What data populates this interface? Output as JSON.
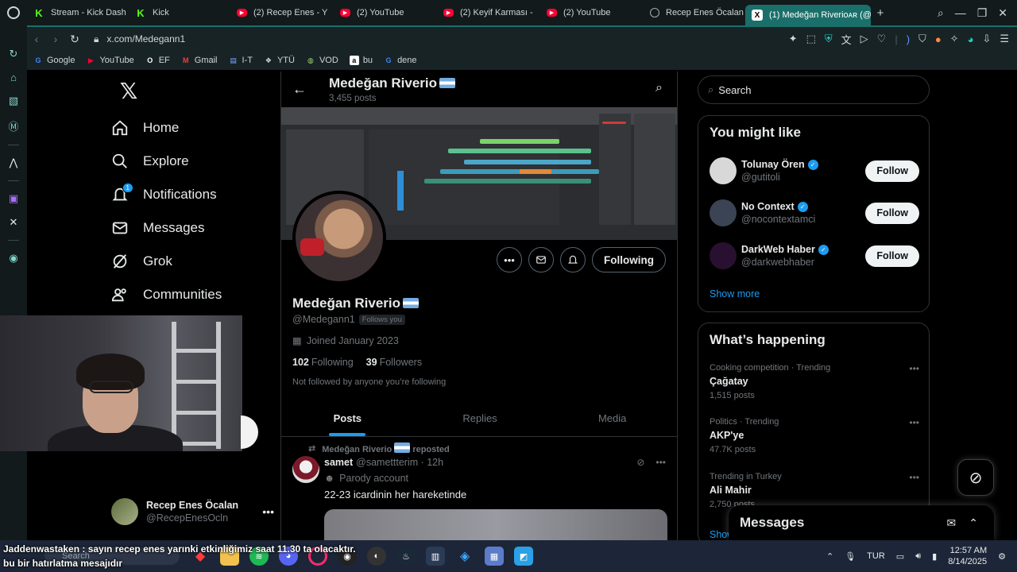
{
  "browser": {
    "tabs": [
      {
        "label": "Stream - Kick Dash",
        "icon": "kick-icon",
        "active": false
      },
      {
        "label": "Kick",
        "icon": "kick-icon",
        "active": false
      },
      {
        "label": "(2) Recep Enes - Y",
        "icon": "youtube-icon",
        "active": false
      },
      {
        "label": "(2) YouTube",
        "icon": "youtube-icon",
        "active": false
      },
      {
        "label": "(2) Keyif Karması -",
        "icon": "youtube-icon",
        "active": false
      },
      {
        "label": "(2) YouTube",
        "icon": "youtube-icon",
        "active": false
      },
      {
        "label": "Recep Enes Öcalan",
        "icon": "globe-icon",
        "active": false
      },
      {
        "label": "(1) Medeğan Riverioᴀʀ (@",
        "icon": "x-icon",
        "active": true
      }
    ],
    "url": "x.com/Medegann1",
    "bookmarks": [
      {
        "label": "Google",
        "icon": "google-icon"
      },
      {
        "label": "YouTube",
        "icon": "youtube-icon"
      },
      {
        "label": "EF",
        "icon": "ef-icon"
      },
      {
        "label": "Gmail",
        "icon": "gmail-icon"
      },
      {
        "label": "I-T",
        "icon": "folder-icon"
      },
      {
        "label": "YTÜ",
        "icon": "ytu-icon"
      },
      {
        "label": "VOD",
        "icon": "vod-icon"
      },
      {
        "label": "bu",
        "icon": "amazon-icon"
      },
      {
        "label": "dene",
        "icon": "google-icon"
      }
    ],
    "accent": "#1b6f6a"
  },
  "x_nav": {
    "items": [
      {
        "label": "Home",
        "icon": "home-icon"
      },
      {
        "label": "Explore",
        "icon": "search-icon"
      },
      {
        "label": "Notifications",
        "icon": "bell-icon",
        "badge": "1"
      },
      {
        "label": "Messages",
        "icon": "mail-icon"
      },
      {
        "label": "Grok",
        "icon": "grok-icon"
      },
      {
        "label": "Communities",
        "icon": "people-icon"
      }
    ],
    "account": {
      "name": "Recep Enes Öcalan",
      "handle": "@RecepEnesOcln"
    }
  },
  "profile": {
    "header_name": "Medeğan Riverio",
    "header_posts": "3,455 posts",
    "name": "Medeğan Riverio",
    "handle": "@Medegann1",
    "follows_you": "Follows you",
    "joined": "Joined January 2023",
    "following_count": "102",
    "following_label": "Following",
    "followers_count": "39",
    "followers_label": "Followers",
    "not_followed": "Not followed by anyone you’re following",
    "following_button": "Following",
    "tabs": [
      "Posts",
      "Replies",
      "Media"
    ]
  },
  "tweet": {
    "repost_by": "Medeğan Riverio",
    "repost_label": "reposted",
    "author_name": "samet",
    "author_handle": "@samettterim",
    "time": "12h",
    "parody_label": "Parody account",
    "text": "22-23 icardinin her hareketinde"
  },
  "right": {
    "search_placeholder": "Search",
    "might_like_title": "You might like",
    "suggestions": [
      {
        "name": "Tolunay Ören",
        "handle": "@gutitoli",
        "follow": "Follow",
        "color": "#d8d8d8"
      },
      {
        "name": "No Context",
        "handle": "@nocontextamci",
        "follow": "Follow",
        "color": "#3b4455"
      },
      {
        "name": "DarkWeb Haber",
        "handle": "@darkwebhaber",
        "follow": "Follow",
        "color": "#2a1030"
      }
    ],
    "show_more": "Show more",
    "happening_title": "What’s happening",
    "trends": [
      {
        "meta": "Cooking competition · Trending",
        "name": "Çağatay",
        "count": "1,515 posts"
      },
      {
        "meta": "Politics · Trending",
        "name": "AKP'ye",
        "count": "47.7K posts"
      },
      {
        "meta": "Trending in Turkey",
        "name": "Ali Mahir",
        "count": "2,750 posts"
      }
    ],
    "show_short": "Show",
    "messages_title": "Messages"
  },
  "chat_overlay": {
    "line1": "Jaddenwastaken : sayın recep enes yarınki etkinliğimiz saat 11.30 ta olacaktır.",
    "line2": "bu bir hatırlatma mesajıdır"
  },
  "taskbar": {
    "search": "Search",
    "language": "TUR",
    "time": "12:57 AM",
    "date": "8/14/2025"
  }
}
